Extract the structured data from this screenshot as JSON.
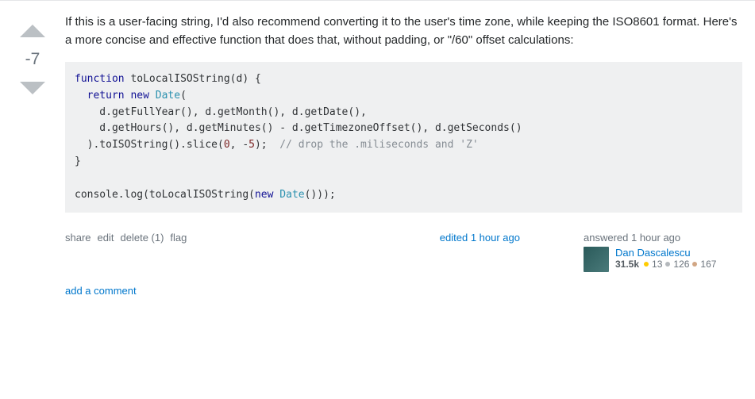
{
  "vote": {
    "score": "-7"
  },
  "prose": "If this is a user-facing string, I'd also recommend converting it to the user's time zone, while keeping the ISO8601 format. Here's a more concise and effective function that does that, without padding, or \"/60\" offset calculations:",
  "code": {
    "l1a": "function",
    "l1b": " toLocalISOString(d) {",
    "l2a": "  ",
    "l2b": "return",
    "l2c": " ",
    "l2d": "new",
    "l2e": " ",
    "l2f": "Date",
    "l2g": "(",
    "l3": "    d.getFullYear(), d.getMonth(), d.getDate(),",
    "l4": "    d.getHours(), d.getMinutes() - d.getTimezoneOffset(), d.getSeconds()",
    "l5a": "  ).toISOString().slice(",
    "l5b": "0",
    "l5c": ", -",
    "l5d": "5",
    "l5e": ");  ",
    "l5f": "// drop the .miliseconds and 'Z'",
    "l6": "}",
    "l8a": "console.log(toLocalISOString(",
    "l8b": "new",
    "l8c": " ",
    "l8d": "Date",
    "l8e": "()));"
  },
  "actions": {
    "share": "share",
    "edit": "edit",
    "delete": "delete (1)",
    "flag": "flag"
  },
  "edited": "edited 1 hour ago",
  "user": {
    "answered": "answered 1 hour ago",
    "name": "Dan Dascalescu",
    "rep": "31.5k",
    "gold": "13",
    "silver": "126",
    "bronze": "167"
  },
  "add_comment": "add a comment"
}
